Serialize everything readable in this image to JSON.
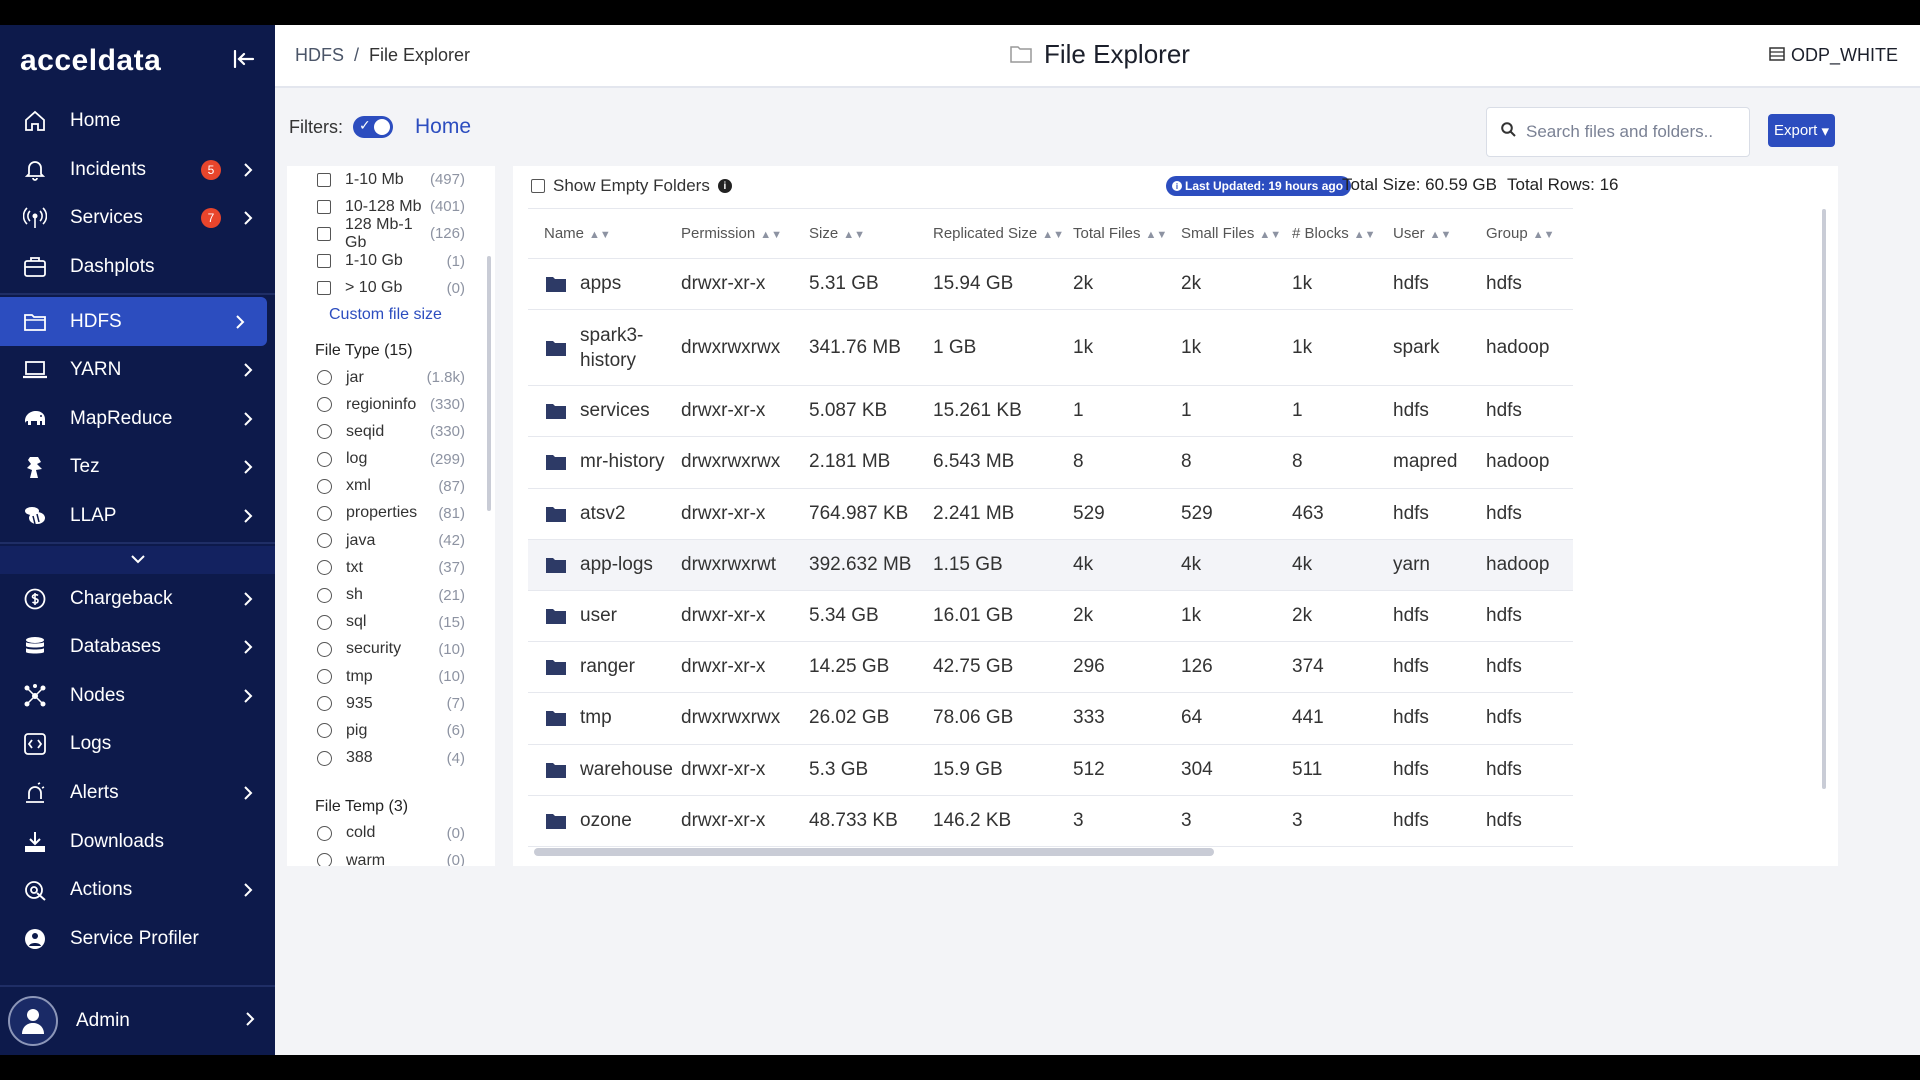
{
  "brand": {
    "name": "acceldata"
  },
  "sidebar": {
    "items": [
      {
        "label": "Home",
        "icon": "home-icon"
      },
      {
        "label": "Incidents",
        "icon": "bell-icon",
        "badge": "5",
        "chevron": true
      },
      {
        "label": "Services",
        "icon": "broadcast-icon",
        "badge": "7",
        "chevron": true
      },
      {
        "label": "Dashplots",
        "icon": "dashboard-icon"
      },
      {
        "label": "HDFS",
        "icon": "folder-icon",
        "chevron": true,
        "active": true
      },
      {
        "label": "YARN",
        "icon": "laptop-icon",
        "chevron": true
      },
      {
        "label": "MapReduce",
        "icon": "elephant-icon",
        "chevron": true
      },
      {
        "label": "Tez",
        "icon": "tez-icon",
        "chevron": true
      },
      {
        "label": "LLAP",
        "icon": "bee-icon",
        "chevron": true
      },
      {
        "label": "Chargeback",
        "icon": "dollar-icon",
        "chevron": true
      },
      {
        "label": "Databases",
        "icon": "database-icon",
        "chevron": true
      },
      {
        "label": "Nodes",
        "icon": "nodes-icon",
        "chevron": true
      },
      {
        "label": "Logs",
        "icon": "code-icon"
      },
      {
        "label": "Alerts",
        "icon": "alert-icon",
        "chevron": true
      },
      {
        "label": "Downloads",
        "icon": "download-icon"
      },
      {
        "label": "Actions",
        "icon": "actions-icon",
        "chevron": true
      },
      {
        "label": "Service Profiler",
        "icon": "profiler-icon"
      }
    ],
    "admin": {
      "label": "Admin"
    }
  },
  "header": {
    "breadcrumb": [
      "HDFS",
      "File Explorer"
    ],
    "title": "File Explorer",
    "cluster": "ODP_WHITE"
  },
  "filters": {
    "label": "Filters:",
    "home": "Home",
    "search_placeholder": "Search files and folders..",
    "export_label": "Export",
    "size_options": [
      {
        "name": "1-10 Mb",
        "count": "(497)"
      },
      {
        "name": "10-128 Mb",
        "count": "(401)"
      },
      {
        "name": "128 Mb-1 Gb",
        "count": "(126)"
      },
      {
        "name": "1-10 Gb",
        "count": "(1)"
      },
      {
        "name": "> 10 Gb",
        "count": "(0)"
      }
    ],
    "custom_size": "Custom file size",
    "file_type_title": "File Type (15)",
    "file_types": [
      {
        "name": "jar",
        "count": "(1.8k)"
      },
      {
        "name": "regioninfo",
        "count": "(330)"
      },
      {
        "name": "seqid",
        "count": "(330)"
      },
      {
        "name": "log",
        "count": "(299)"
      },
      {
        "name": "xml",
        "count": "(87)"
      },
      {
        "name": "properties",
        "count": "(81)"
      },
      {
        "name": "java",
        "count": "(42)"
      },
      {
        "name": "txt",
        "count": "(37)"
      },
      {
        "name": "sh",
        "count": "(21)"
      },
      {
        "name": "sql",
        "count": "(15)"
      },
      {
        "name": "security",
        "count": "(10)"
      },
      {
        "name": "tmp",
        "count": "(10)"
      },
      {
        "name": "935",
        "count": "(7)"
      },
      {
        "name": "pig",
        "count": "(6)"
      },
      {
        "name": "388",
        "count": "(4)"
      }
    ],
    "file_temp_title": "File Temp (3)",
    "file_temps": [
      {
        "name": "cold",
        "count": "(0)"
      },
      {
        "name": "warm",
        "count": "(0)"
      }
    ]
  },
  "table": {
    "show_empty": "Show Empty Folders",
    "last_updated": "Last Updated: 19 hours ago",
    "total_size": "Total Size: 60.59 GB",
    "total_rows": "Total Rows: 16",
    "columns": [
      "Name",
      "Permission",
      "Size",
      "Replicated Size",
      "Total Files",
      "Small Files",
      "# Blocks",
      "User",
      "Group"
    ],
    "rows": [
      [
        "apps",
        "drwxr-xr-x",
        "5.31 GB",
        "15.94 GB",
        "2k",
        "2k",
        "1k",
        "hdfs",
        "hdfs"
      ],
      [
        "spark3-history",
        "drwxrwxrwx",
        "341.76 MB",
        "1 GB",
        "1k",
        "1k",
        "1k",
        "spark",
        "hadoop"
      ],
      [
        "services",
        "drwxr-xr-x",
        "5.087 KB",
        "15.261 KB",
        "1",
        "1",
        "1",
        "hdfs",
        "hdfs"
      ],
      [
        "mr-history",
        "drwxrwxrwx",
        "2.181 MB",
        "6.543 MB",
        "8",
        "8",
        "8",
        "mapred",
        "hadoop"
      ],
      [
        "atsv2",
        "drwxr-xr-x",
        "764.987 KB",
        "2.241 MB",
        "529",
        "529",
        "463",
        "hdfs",
        "hdfs"
      ],
      [
        "app-logs",
        "drwxrwxrwt",
        "392.632 MB",
        "1.15 GB",
        "4k",
        "4k",
        "4k",
        "yarn",
        "hadoop"
      ],
      [
        "user",
        "drwxr-xr-x",
        "5.34 GB",
        "16.01 GB",
        "2k",
        "1k",
        "2k",
        "hdfs",
        "hdfs"
      ],
      [
        "ranger",
        "drwxr-xr-x",
        "14.25 GB",
        "42.75 GB",
        "296",
        "126",
        "374",
        "hdfs",
        "hdfs"
      ],
      [
        "tmp",
        "drwxrwxrwx",
        "26.02 GB",
        "78.06 GB",
        "333",
        "64",
        "441",
        "hdfs",
        "hdfs"
      ],
      [
        "warehouse",
        "drwxr-xr-x",
        "5.3 GB",
        "15.9 GB",
        "512",
        "304",
        "511",
        "hdfs",
        "hdfs"
      ],
      [
        "ozone",
        "drwxr-xr-x",
        "48.733 KB",
        "146.2 KB",
        "3",
        "3",
        "3",
        "hdfs",
        "hdfs"
      ]
    ]
  },
  "colors": {
    "sidebar": "#0d1a4b",
    "accent": "#2c4dbf",
    "badge": "#e8452c"
  }
}
